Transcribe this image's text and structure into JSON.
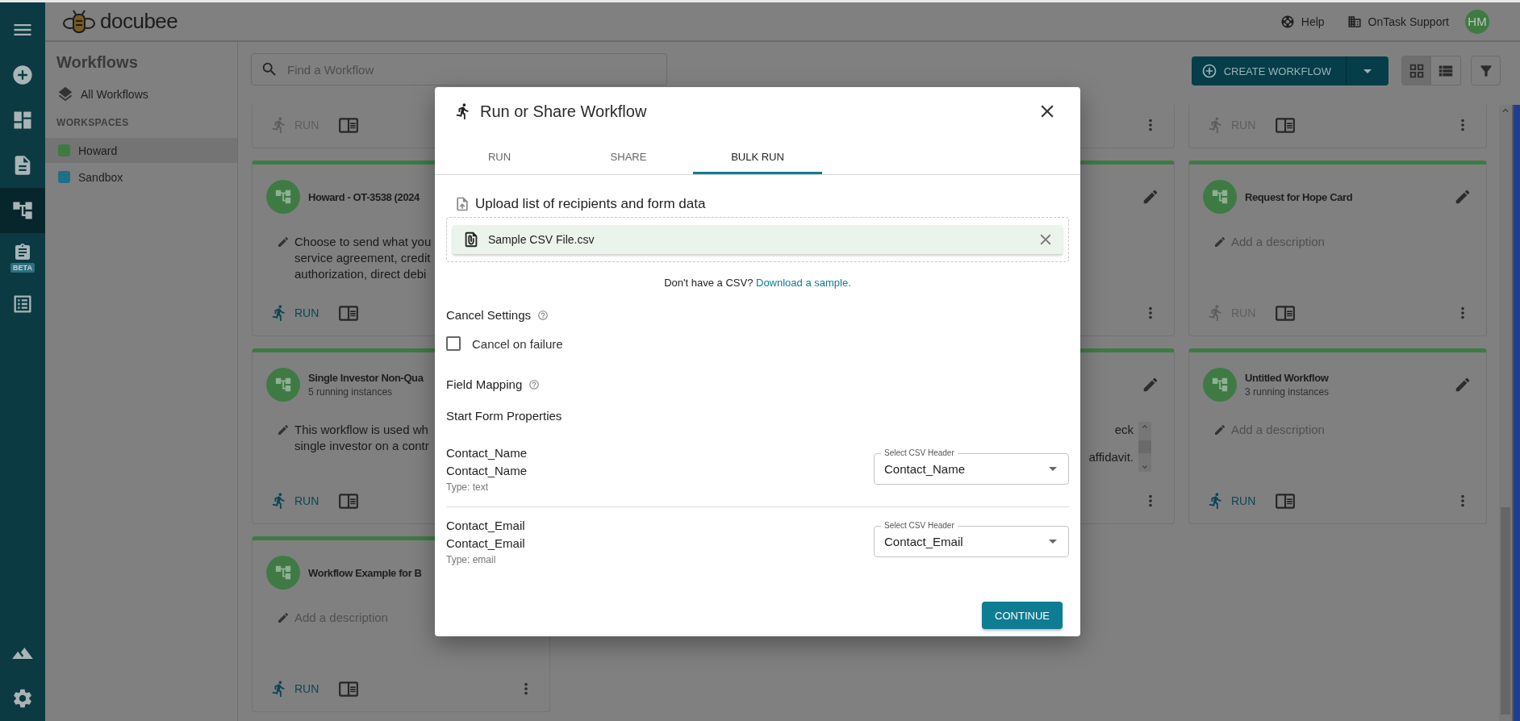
{
  "app": {
    "logo_text": "docubee"
  },
  "rail": [
    {
      "kind": "menu",
      "selected": false
    },
    {
      "kind": "add",
      "selected": false
    },
    {
      "kind": "dashboard",
      "selected": false
    },
    {
      "kind": "documents",
      "selected": false
    },
    {
      "kind": "workflows",
      "selected": true
    },
    {
      "kind": "forms",
      "badge": "BETA",
      "selected": false
    },
    {
      "kind": "list",
      "selected": false
    }
  ],
  "rail_bottom": [
    {
      "kind": "mountain",
      "selected": false
    },
    {
      "kind": "settings",
      "selected": false
    }
  ],
  "header": {
    "help": "Help",
    "org": "OnTask Support",
    "avatar": "HM"
  },
  "sidebar": {
    "title": "Workflows",
    "all_link": "All Workflows",
    "section": "WORKSPACES",
    "workspaces": [
      {
        "name": "Howard",
        "color": "#3f7a45",
        "selected": true
      },
      {
        "name": "Sandbox",
        "color": "#1f6f8c",
        "selected": false
      }
    ]
  },
  "toolbar": {
    "search_placeholder": "Find a Workflow",
    "create_button": "CREATE WORKFLOW",
    "view_toggle": [
      {
        "kind": "grid",
        "selected": true
      },
      {
        "kind": "list",
        "selected": false
      }
    ]
  },
  "cards_left": [
    {
      "run": {
        "label": "RUN",
        "disabled": true
      }
    },
    {
      "title": "Howard - OT-3538 (2024",
      "description": {
        "kind": "text",
        "lines": [
          "Choose to send what you",
          "service agreement, credit",
          "authorization, direct debi"
        ]
      },
      "run": {
        "label": "RUN",
        "disabled": false
      }
    },
    {
      "title": "Single Investor Non-Qua",
      "subtitle": "5 running instances",
      "description": {
        "kind": "text",
        "lines": [
          "This workflow is used wh",
          "single investor on a contr"
        ]
      },
      "run": {
        "label": "RUN",
        "disabled": false
      }
    },
    {
      "title": "Workflow Example for B",
      "description": {
        "kind": "placeholder",
        "lines": [
          "Add a description"
        ]
      },
      "run": {
        "label": "RUN",
        "disabled": false
      },
      "menu_button": true
    }
  ],
  "cards_middle": [
    {
      "menu_button": true
    },
    {
      "edit_button": true,
      "menu_button": true
    },
    {
      "edit_button": true,
      "menu_button": true,
      "description": {
        "kind": "scrolled",
        "lines": [
          "eck",
          "affidavit."
        ]
      }
    }
  ],
  "cards_right": [
    {
      "run": {
        "label": "RUN",
        "disabled": true
      },
      "menu_button": true
    },
    {
      "title": "Request for Hope Card",
      "description": {
        "kind": "placeholder",
        "lines": [
          "Add a description"
        ]
      },
      "run": {
        "label": "RUN",
        "disabled": true
      },
      "edit_button": true,
      "menu_button": true
    },
    {
      "title": "Untitled Workflow",
      "subtitle": "3 running instances",
      "description": {
        "kind": "placeholder",
        "lines": [
          "Add a description"
        ]
      },
      "run": {
        "label": "RUN",
        "disabled": false
      },
      "edit_button": true,
      "menu_button": true
    }
  ],
  "dialog": {
    "title": "Run or Share Workflow",
    "tabs": [
      {
        "label": "RUN",
        "selected": false
      },
      {
        "label": "SHARE",
        "selected": false
      },
      {
        "label": "BULK RUN",
        "selected": true
      }
    ],
    "upload_heading": "Upload list of recipients and form data",
    "file_name": "Sample CSV File.csv",
    "sample_prompt": "Don't have a CSV?",
    "sample_link": "Download a sample.",
    "cancel_heading": "Cancel Settings",
    "cancel_checkbox": {
      "label": "Cancel on failure",
      "checked": false
    },
    "mapping_heading": "Field Mapping",
    "form_heading": "Start Form Properties",
    "mappings": [
      {
        "name": "Contact_Name",
        "label": "Contact_Name",
        "type": "Type: text",
        "select_label": "Select CSV Header",
        "value": "Contact_Name"
      },
      {
        "name": "Contact_Email",
        "label": "Contact_Email",
        "type": "Type: email",
        "select_label": "Select CSV Header",
        "value": "Contact_Email"
      }
    ],
    "continue_button": "CONTINUE"
  }
}
